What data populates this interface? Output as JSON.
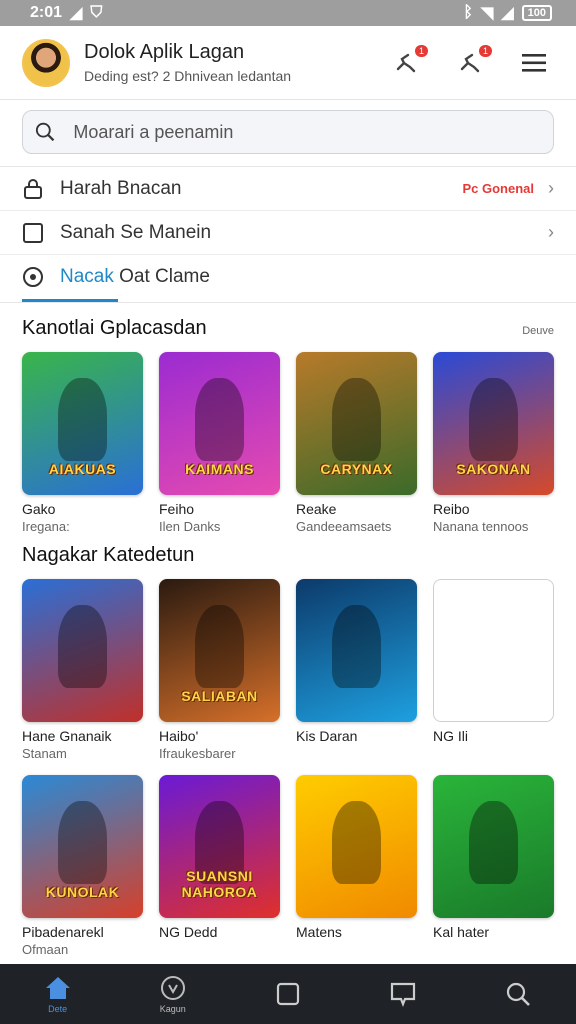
{
  "status_bar": {
    "time": "2:01",
    "battery": "100"
  },
  "header": {
    "title": "Dolok Aplik Lagan",
    "subtitle": "Deding est? 2 Dhnivean ledantan",
    "notif_badge_1": "1",
    "notif_badge_2": "1"
  },
  "search": {
    "placeholder": "Moarari a peenamin"
  },
  "menu": [
    {
      "label": "Harah Bnacan",
      "tag": "Pc Gonenal"
    },
    {
      "label": "Sanah Se Manein",
      "tag": ""
    },
    {
      "label_highlight": "Nacak",
      "label_rest": " Oat Clame"
    }
  ],
  "section1": {
    "title": "Kanotlai Gplacasdan",
    "more": "Deuve",
    "items": [
      {
        "thumb_title": "AIAKUAS",
        "name": "Gako",
        "sub": "Iregana:",
        "colors": [
          "#39b54a",
          "#2a6fd6"
        ]
      },
      {
        "thumb_title": "KAIMANS",
        "name": "Feiho",
        "sub": "Ilen Danks",
        "colors": [
          "#9b2bd1",
          "#e64bb0"
        ]
      },
      {
        "thumb_title": "CARYNAX",
        "name": "Reake",
        "sub": "Gandeeamsaets",
        "colors": [
          "#b87a2a",
          "#3b6a2a"
        ]
      },
      {
        "thumb_title": "SAKONAN",
        "name": "Reibo",
        "sub": "Nanana tennoos",
        "colors": [
          "#2a4ad6",
          "#d64a2a"
        ]
      }
    ]
  },
  "section2": {
    "title": "Nagakar Katedetun",
    "rows": [
      [
        {
          "thumb_title": "",
          "name": "Hane Gnanaik",
          "sub": "Stanam",
          "colors": [
            "#2a6fd6",
            "#c0302a"
          ]
        },
        {
          "thumb_title": "SALIABAN",
          "name": "Haibo'",
          "sub": "Ifraukesbarer",
          "colors": [
            "#2a1a10",
            "#d6702a"
          ]
        },
        {
          "thumb_title": "",
          "name": "Kis Daran",
          "sub": "",
          "colors": [
            "#0c3a6a",
            "#1ea0e0"
          ]
        },
        {
          "thumb_title": "",
          "name": "NG Ili",
          "sub": "",
          "colors": [
            "#ffffff",
            "#ffffff"
          ]
        }
      ],
      [
        {
          "thumb_title": "KUNOLAK",
          "name": "Pibadenarekl",
          "sub": "Ofmaan",
          "colors": [
            "#2a8ad6",
            "#d6402a"
          ]
        },
        {
          "thumb_title": "SUANSNI NAHOROA",
          "name": "NG Dedd",
          "sub": "",
          "colors": [
            "#6a1ad6",
            "#e0302a"
          ]
        },
        {
          "thumb_title": "",
          "name": "Matens",
          "sub": "",
          "colors": [
            "#ffcc00",
            "#f08a00"
          ]
        },
        {
          "thumb_title": "",
          "name": "Kal hater",
          "sub": "",
          "colors": [
            "#2ab53a",
            "#1a7a2a"
          ]
        }
      ]
    ]
  },
  "bottom_nav": [
    {
      "label": "Dete",
      "icon": "home-icon"
    },
    {
      "label": "Kagun",
      "icon": "badge-icon"
    },
    {
      "label": "",
      "icon": "square-icon"
    },
    {
      "label": "",
      "icon": "chat-icon"
    },
    {
      "label": "",
      "icon": "search-icon"
    }
  ]
}
